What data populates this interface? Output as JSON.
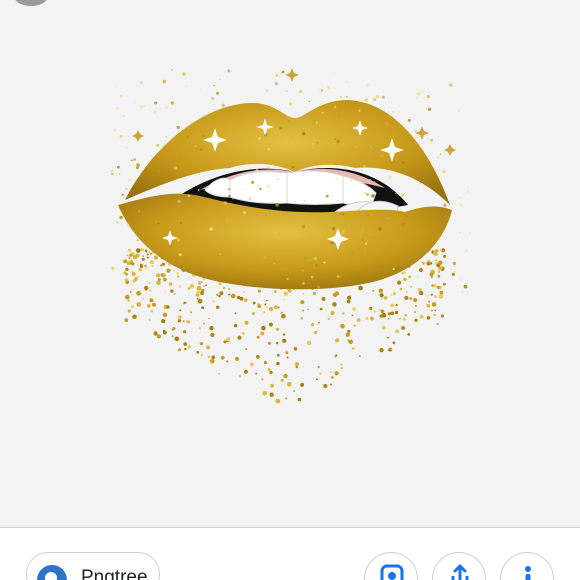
{
  "image_viewer": {
    "subject": "gold-glitter-biting-lips",
    "colors": {
      "gold": "#caa020",
      "gold_dark": "#8a6a10",
      "gums": "#e8b9b0",
      "teeth": "#ffffff",
      "mouth": "#111111"
    }
  },
  "bottom_bar": {
    "source_label": "Pngtree",
    "source_icon": "pngtree-logo-icon",
    "actions": [
      {
        "name": "lens-button",
        "icon": "google-lens-icon"
      },
      {
        "name": "share-button",
        "icon": "share-icon"
      },
      {
        "name": "info-button",
        "icon": "info-icon"
      }
    ],
    "accent_color": "#2f74c9"
  }
}
